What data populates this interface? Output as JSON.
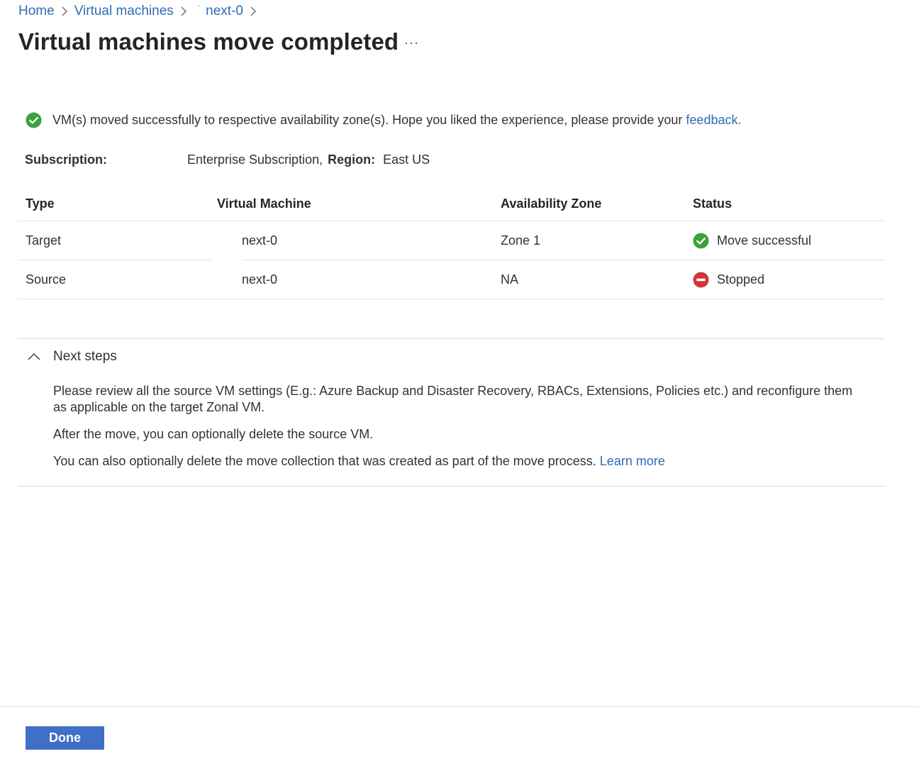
{
  "breadcrumb": {
    "items": [
      "Home",
      "Virtual machines",
      "next-0"
    ],
    "separator_icon": "chevron-right-icon"
  },
  "page": {
    "title": "Virtual machines move completed",
    "more_icon": "ellipsis-icon"
  },
  "banner": {
    "icon": "success-check-icon",
    "text": "VM(s) moved successfully to respective availability zone(s). Hope you liked the experience, please provide your ",
    "link": "feedback."
  },
  "subscription": {
    "label": "Subscription:",
    "value": "Enterprise Subscription,",
    "region_label": "Region:",
    "region_value": "East US"
  },
  "table": {
    "headers": [
      "Type",
      "Virtual Machine",
      "Availability Zone",
      "Status"
    ],
    "rows": [
      {
        "type": "Target",
        "vm": "next-0",
        "zone": "Zone 1",
        "status": "Move successful",
        "status_icon": "success-check-icon"
      },
      {
        "type": "Source",
        "vm": "next-0",
        "zone": "NA",
        "status": "Stopped",
        "status_icon": "stopped-icon"
      }
    ]
  },
  "next_steps": {
    "title": "Next steps",
    "toggle_icon": "chevron-up-icon",
    "paragraphs": [
      "Please review all the source VM settings (E.g.: Azure Backup and Disaster Recovery, RBACs, Extensions, Policies etc.) and reconfigure them as applicable on the target Zonal VM.",
      "After the move, you can optionally delete the source VM.",
      "You can also optionally delete the move collection that was created as part of the move process. "
    ],
    "learn_more": "Learn more"
  },
  "footer": {
    "done_label": "Done"
  },
  "colors": {
    "link": "#2f6db5",
    "success": "#3ca33c",
    "error": "#d13438",
    "primary_button": "#3f6fc7"
  }
}
